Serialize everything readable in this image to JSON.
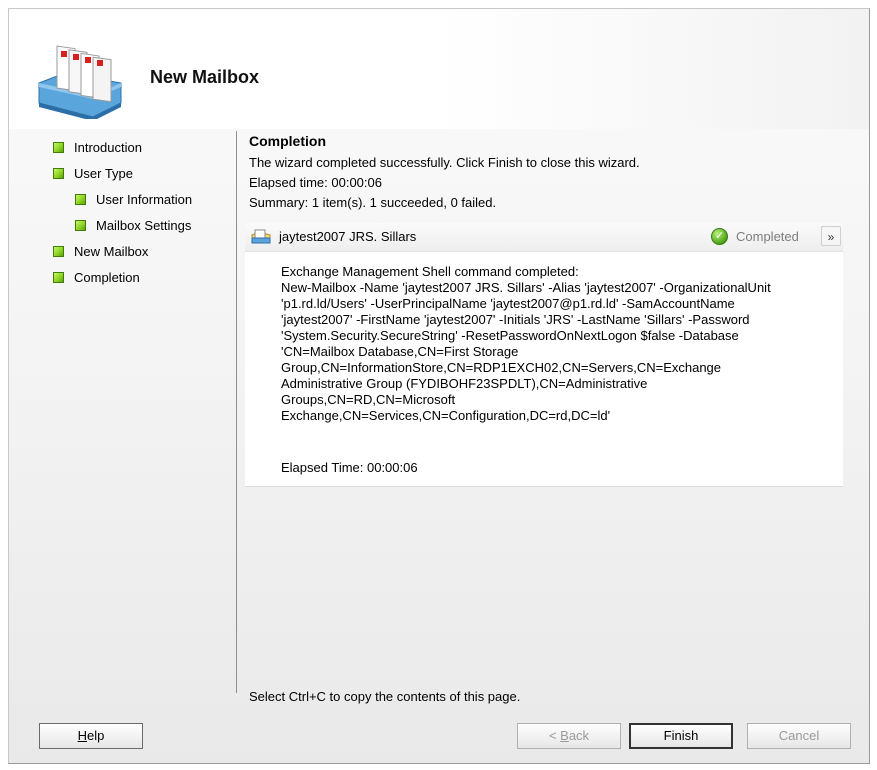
{
  "window": {
    "title": "New Mailbox"
  },
  "nav": {
    "items": [
      {
        "label": "Introduction",
        "level": 0
      },
      {
        "label": "User Type",
        "level": 0
      },
      {
        "label": "User Information",
        "level": 1
      },
      {
        "label": "Mailbox Settings",
        "level": 1
      },
      {
        "label": "New Mailbox",
        "level": 0
      },
      {
        "label": "Completion",
        "level": 0
      }
    ]
  },
  "content": {
    "heading": "Completion",
    "message": "The wizard completed successfully. Click Finish to close this wizard.",
    "elapsed": "Elapsed time: 00:00:06",
    "summary": "Summary: 1 item(s). 1 succeeded, 0 failed."
  },
  "task": {
    "name": "jaytest2007 JRS. Sillars",
    "status": "Completed",
    "status_color": "#4ea51a",
    "icon": "mailbox-icon",
    "command_header": "Exchange Management Shell command completed:",
    "command": "New-Mailbox -Name 'jaytest2007 JRS. Sillars' -Alias 'jaytest2007' -OrganizationalUnit\n'p1.rd.ld/Users' -UserPrincipalName 'jaytest2007@p1.rd.ld' -SamAccountName\n'jaytest2007' -FirstName 'jaytest2007' -Initials 'JRS' -LastName 'Sillars' -Password\n'System.Security.SecureString' -ResetPasswordOnNextLogon $false -Database\n'CN=Mailbox Database,CN=First Storage\nGroup,CN=InformationStore,CN=RDP1EXCH02,CN=Servers,CN=Exchange\nAdministrative Group (FYDIBOHF23SPDLT),CN=Administrative\nGroups,CN=RD,CN=Microsoft\nExchange,CN=Services,CN=Configuration,DC=rd,DC=ld'",
    "elapsed": "Elapsed Time: 00:00:06"
  },
  "footer": {
    "copy_hint": "Select Ctrl+C to copy the contents of this page.",
    "help_label": "Help",
    "back_label": "< Back",
    "finish_label": "Finish",
    "cancel_label": "Cancel"
  }
}
